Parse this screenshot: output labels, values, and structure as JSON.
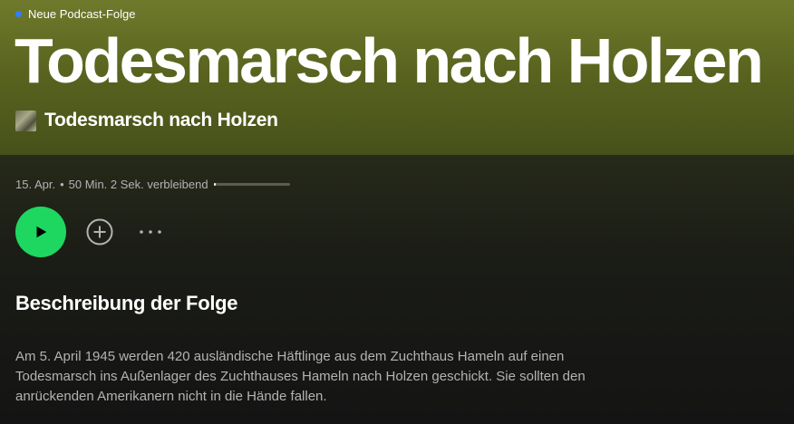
{
  "badge": {
    "label": "Neue Podcast-Folge",
    "color": "#2f7fff"
  },
  "episode": {
    "title": "Todesmarsch nach Holzen",
    "show_name": "Todesmarsch nach Holzen",
    "date": "15. Apr.",
    "separator": "•",
    "remaining": "50 Min. 2 Sek. verbleibend",
    "progress_fraction": 0.02
  },
  "controls": {
    "play_icon": "play-icon",
    "add_icon": "add-circle-icon",
    "more_icon": "more-icon",
    "play_color": "#1ed760"
  },
  "description": {
    "heading": "Beschreibung der Folge",
    "text": "Am 5. April 1945 werden 420 ausländische Häftlinge aus dem Zuchthaus Hameln auf einen Todesmarsch ins Außenlager des Zuchthauses Hameln nach Holzen geschickt. Sie sollten den anrückenden Amerikanern nicht in die Hände fallen."
  },
  "colors": {
    "hero_top": "#6f7a2c",
    "background": "#121212",
    "muted_text": "#b3b3b3"
  }
}
